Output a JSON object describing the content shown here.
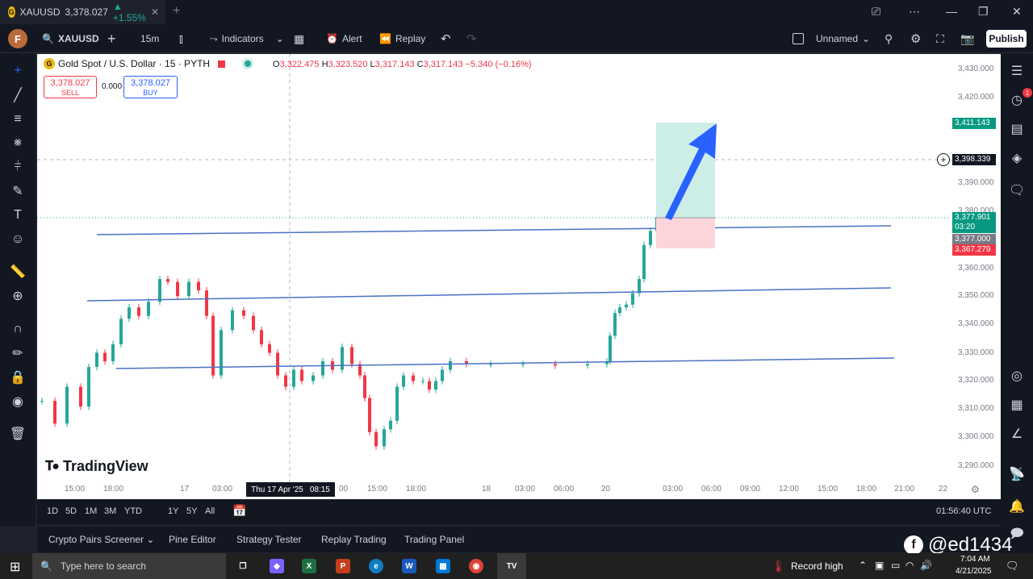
{
  "browser_tab": {
    "symbol": "XAUUSD",
    "price": "3,378.027",
    "change": "▲ +1.55%",
    "close": "✕",
    "new_tab": "+"
  },
  "window_controls": {
    "cast": "⎚",
    "more": "⋯",
    "minimize": "—",
    "restore": "❐",
    "close": "✕"
  },
  "toolbar": {
    "avatar": "F",
    "symbol": "XAUUSD",
    "add_symbol": "+",
    "interval": "15m",
    "chart_type": "⫾",
    "indicators": "Indicators",
    "templates": "▦",
    "alert": "Alert",
    "replay": "Replay",
    "undo": "↶",
    "redo": "↷",
    "layout_name": "Unnamed",
    "publish": "Publish"
  },
  "chart": {
    "title": "Gold Spot / U.S. Dollar · 15 · PYTH",
    "ohlc": {
      "o_label": "O",
      "o": "3,322.475",
      "h_label": "H",
      "h": "3,323.520",
      "l_label": "L",
      "l": "3,317.143",
      "c_label": "C",
      "c": "3,317.143",
      "change": "−5.340 (−0.16%)"
    },
    "sell": {
      "price": "3,378.027",
      "label": "SELL"
    },
    "buy": {
      "price": "3,378.027",
      "label": "BUY"
    },
    "spread": "0.000",
    "logo": "TradingView"
  },
  "price_axis": [
    "3,430.000",
    "3,420.000",
    "3,390.000",
    "3,380.000",
    "3,360.000",
    "3,350.000",
    "3,340.000",
    "3,330.000",
    "3,320.000",
    "3,310.000",
    "3,300.000",
    "3,290.000"
  ],
  "price_tags": {
    "target": "3,411.143",
    "crosshair": "3,398.339",
    "last": "3,377.901",
    "countdown": "03:20",
    "entry": "3,377.000",
    "stop": "3,367.279"
  },
  "time_axis": [
    "15:00",
    "18:00",
    "17",
    "03:00",
    "00",
    "15:00",
    "18:00",
    "18",
    "03:00",
    "06:00",
    "20",
    "03:00",
    "06:00",
    "09:00",
    "12:00",
    "15:00",
    "18:00",
    "21:00",
    "22"
  ],
  "crosshair_time": {
    "date": "Thu 17 Apr '25",
    "time": "08:15"
  },
  "range_bar": {
    "ranges": [
      "1D",
      "5D",
      "1M",
      "3M",
      "YTD",
      "1Y",
      "5Y",
      "All"
    ],
    "clock": "01:56:40 UTC"
  },
  "bottom_tabs": [
    "Crypto Pairs Screener",
    "Pine Editor",
    "Strategy Tester",
    "Replay Trading",
    "Trading Panel"
  ],
  "taskbar": {
    "search": "Type here to search",
    "weather": "Record high",
    "time": "7:04 AM",
    "date": "4/21/2025"
  },
  "watermark": "@ed1434",
  "notification_count": "1",
  "colors": {
    "up": "#26a69a",
    "down": "#f23645",
    "trendline": "#4a72c4",
    "arrow": "#2962ff",
    "target_zone": "#cdeee7",
    "stop_zone": "#fbd5da"
  }
}
